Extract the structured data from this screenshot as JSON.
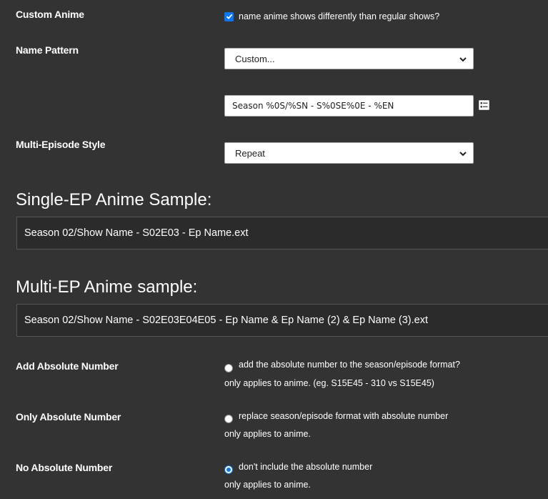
{
  "custom_anime": {
    "label": "Custom Anime",
    "checkbox_checked": true,
    "checkbox_text": "name anime shows differently than regular shows?"
  },
  "name_pattern": {
    "label": "Name Pattern",
    "selected": "Custom...",
    "custom_value": "Season %0S/%SN - S%0SE%0E - %EN",
    "help_icon": "list-details-icon"
  },
  "multi_episode": {
    "label": "Multi-Episode Style",
    "selected": "Repeat"
  },
  "single_sample": {
    "heading": "Single-EP Anime Sample:",
    "value": "Season 02/Show Name - S02E03 - Ep Name.ext"
  },
  "multi_sample": {
    "heading": "Multi-EP Anime sample:",
    "value": "Season 02/Show Name - S02E03E04E05 - Ep Name & Ep Name (2) & Ep Name (3).ext"
  },
  "absolute_options": [
    {
      "label": "Add Absolute Number",
      "radio_text": "add the absolute number to the season/episode format?",
      "helper": "only applies to anime. (eg. S15E45 - 310 vs S15E45)",
      "checked": false
    },
    {
      "label": "Only Absolute Number",
      "radio_text": "replace season/episode format with absolute number",
      "helper": "only applies to anime.",
      "checked": false
    },
    {
      "label": "No Absolute Number",
      "radio_text": "don't include the absolute number",
      "helper": "only applies to anime.",
      "checked": true
    }
  ],
  "colors": {
    "background": "#333333",
    "accent": "#0a76f6",
    "sample_box": "#2b2b2b"
  }
}
